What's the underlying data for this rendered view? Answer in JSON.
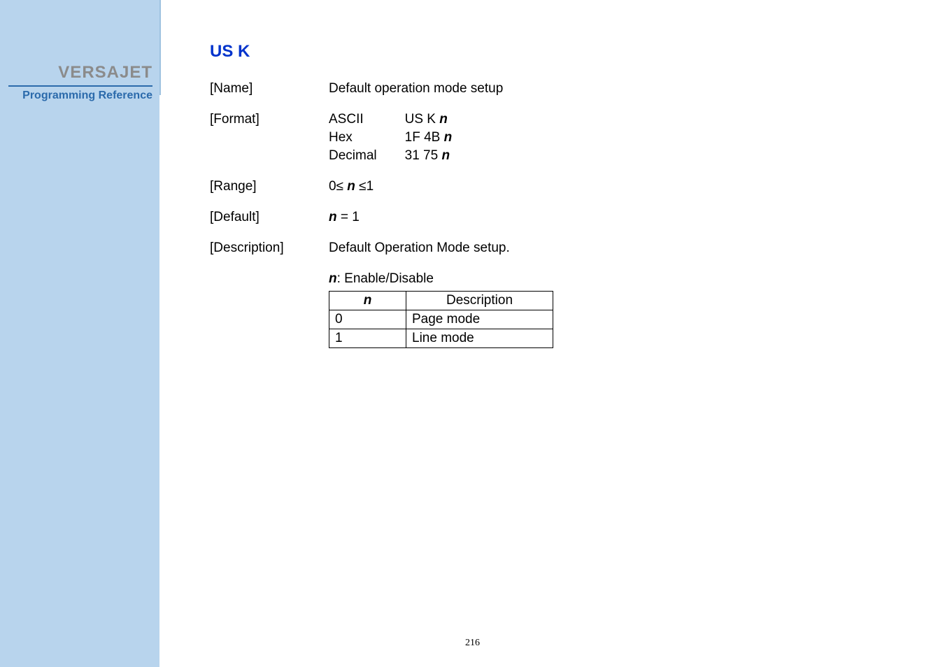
{
  "sidebar": {
    "brand": "VERSAJET",
    "subref": "Programming Reference"
  },
  "title": "US K",
  "rows": {
    "name": {
      "label": "[Name]",
      "value": "Default operation mode setup"
    },
    "format": {
      "label": "[Format]",
      "cols": {
        "c1": [
          "ASCII",
          "Hex",
          "Decimal"
        ],
        "c2_pre": [
          "US K ",
          "1F 4B ",
          "31 75 "
        ],
        "c2_var": "n"
      }
    },
    "range": {
      "label": "[Range]",
      "pre": "0≤ ",
      "var": "n",
      "post": " ≤1"
    },
    "default": {
      "label": "[Default]",
      "var": "n",
      "post": " = 1"
    },
    "description": {
      "label": "[Description]",
      "value": "Default Operation Mode setup."
    }
  },
  "table": {
    "caption_var": "n",
    "caption_rest": ": Enable/Disable",
    "head_n": "n",
    "head_desc": "Description",
    "rows": [
      {
        "n": "0",
        "desc": "Page mode"
      },
      {
        "n": "1",
        "desc": "Line mode"
      }
    ]
  },
  "page_number": "216"
}
